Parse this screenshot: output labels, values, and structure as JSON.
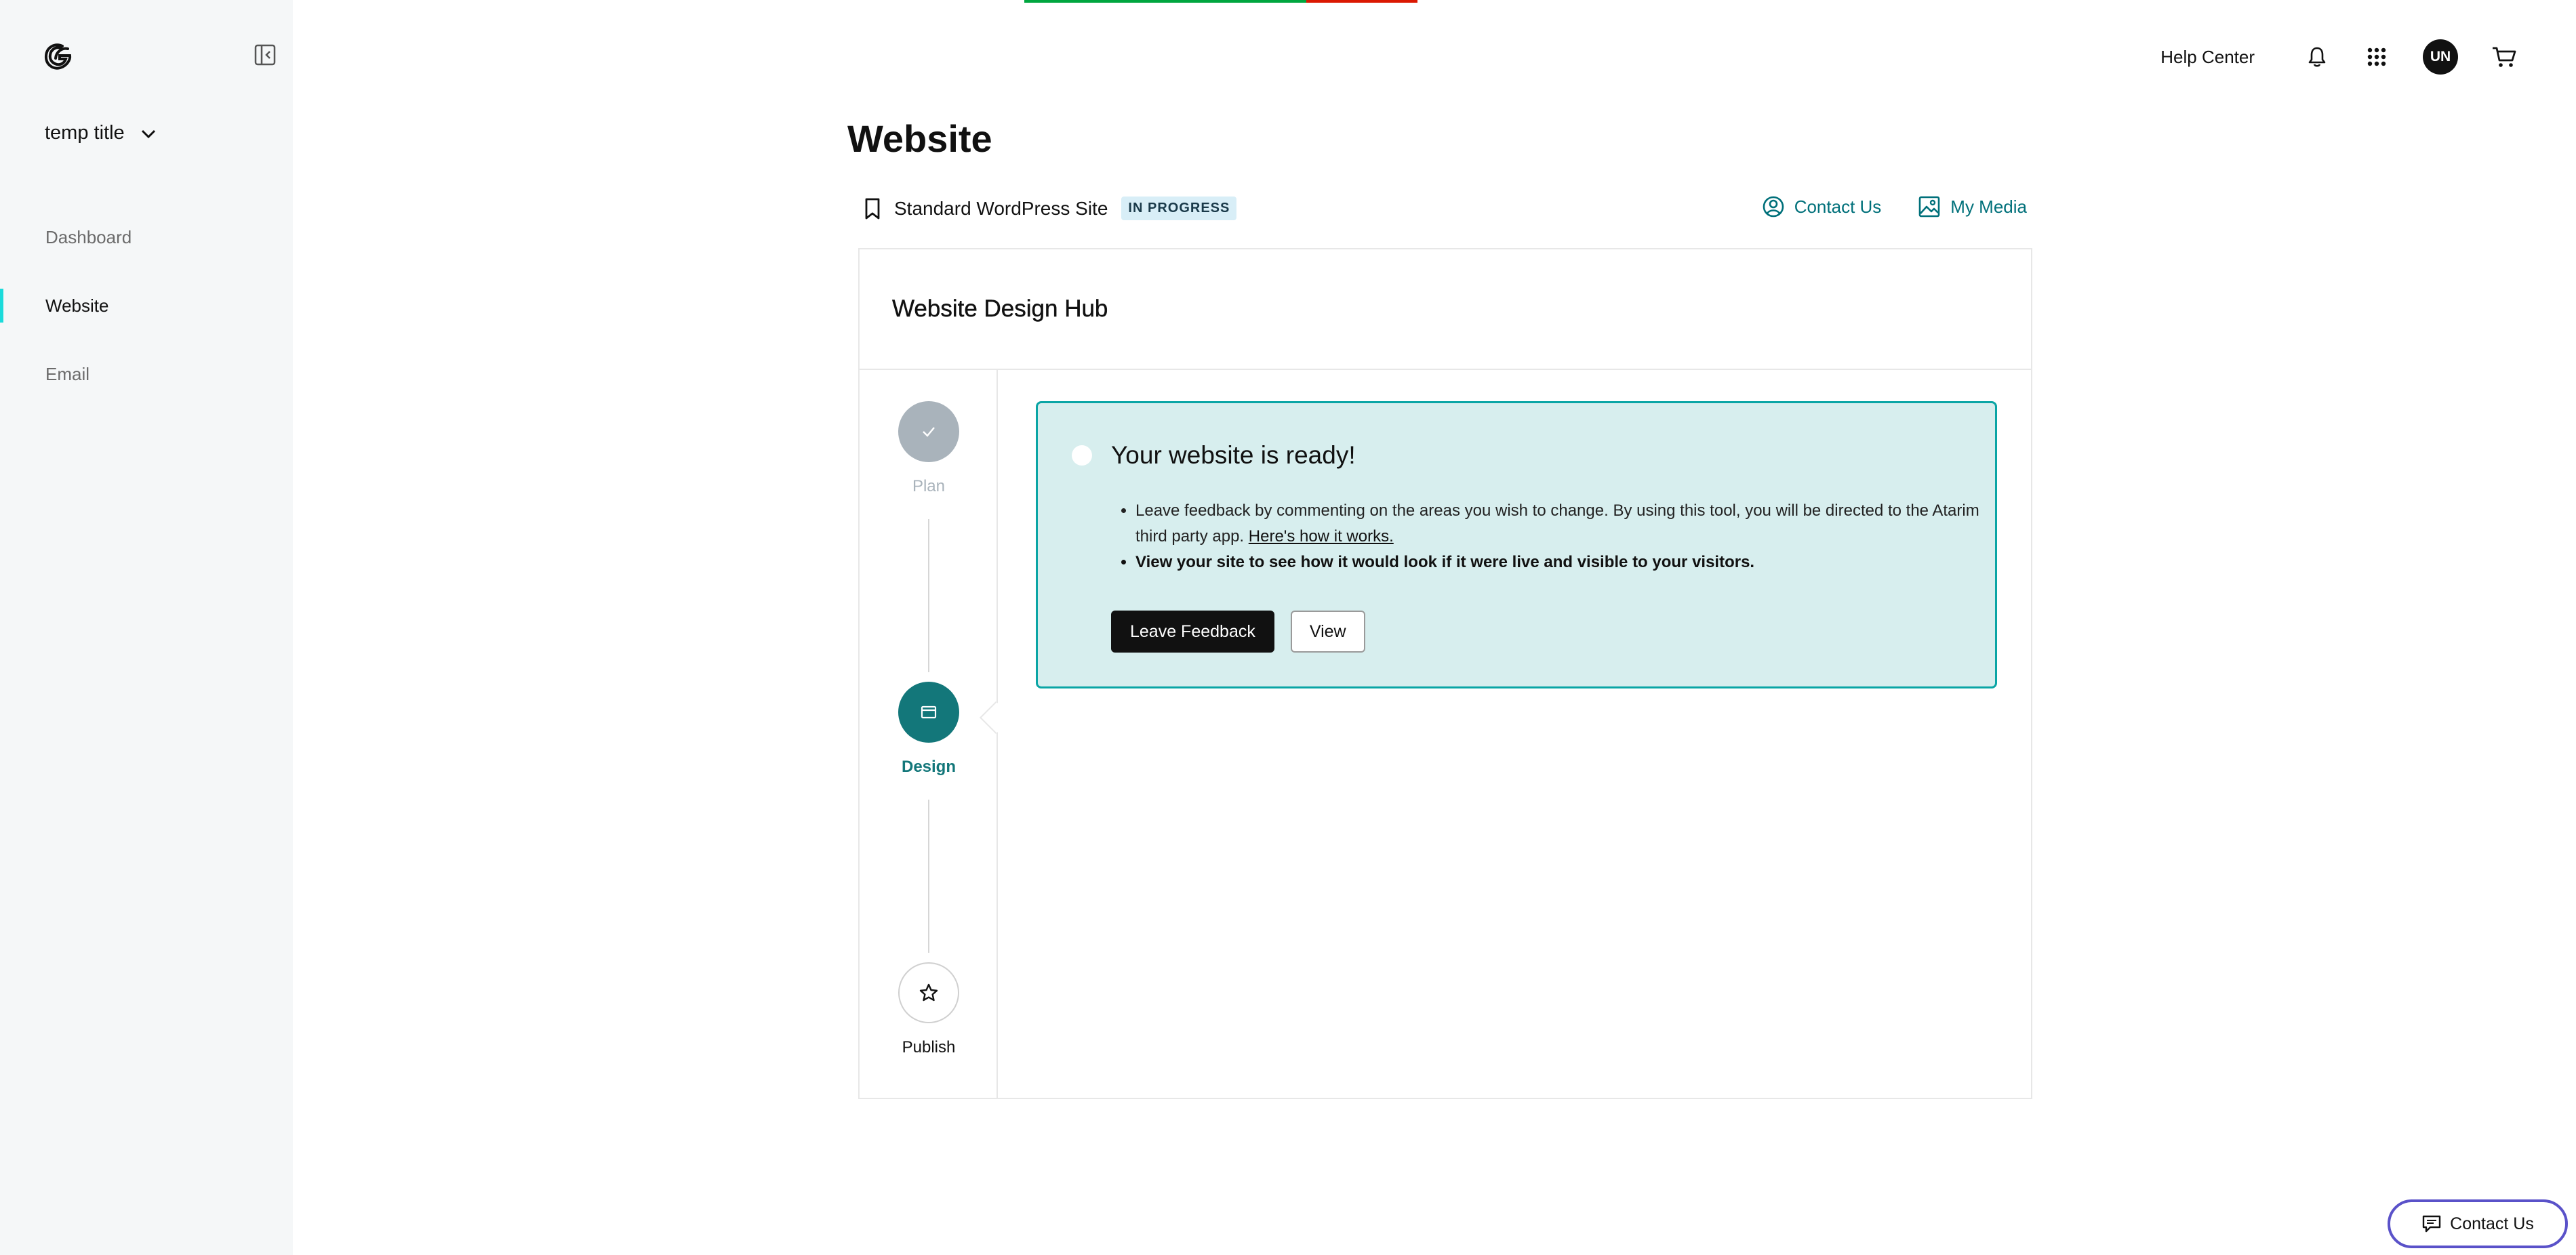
{
  "colors": {
    "accent": "#13777a",
    "accent_border": "#0aa5a5",
    "ready_bg": "#d7eeee",
    "nav_indicator": "#1bdbdb",
    "link": "#00707a"
  },
  "sidebar": {
    "account_title": "temp title",
    "items": [
      {
        "label": "Dashboard",
        "active": false
      },
      {
        "label": "Website",
        "active": true
      },
      {
        "label": "Email",
        "active": false
      }
    ]
  },
  "header": {
    "help_center": "Help Center",
    "avatar_initials": "UN",
    "icons": [
      "bell-icon",
      "apps-grid-icon",
      "cart-icon"
    ]
  },
  "page": {
    "title": "Website",
    "site_type": "Standard WordPress Site",
    "status_badge": "IN PROGRESS",
    "contact_link": "Contact Us",
    "media_link": "My Media"
  },
  "hub": {
    "title": "Website Design Hub",
    "steps": [
      {
        "label": "Plan",
        "state": "complete"
      },
      {
        "label": "Design",
        "state": "current"
      },
      {
        "label": "Publish",
        "state": "upcoming"
      }
    ],
    "card": {
      "title": "Your website is ready!",
      "bullet1_text": "Leave feedback by commenting on the areas you wish to change. By using this tool, you will be directed to the Atarim third party app.",
      "bullet1_link": "Here's how it works.",
      "bullet2_text": "View your site to see how it would look if it were live and visible to your visitors.",
      "primary_button": "Leave Feedback",
      "secondary_button": "View"
    }
  },
  "floating": {
    "contact_label": "Contact Us"
  }
}
